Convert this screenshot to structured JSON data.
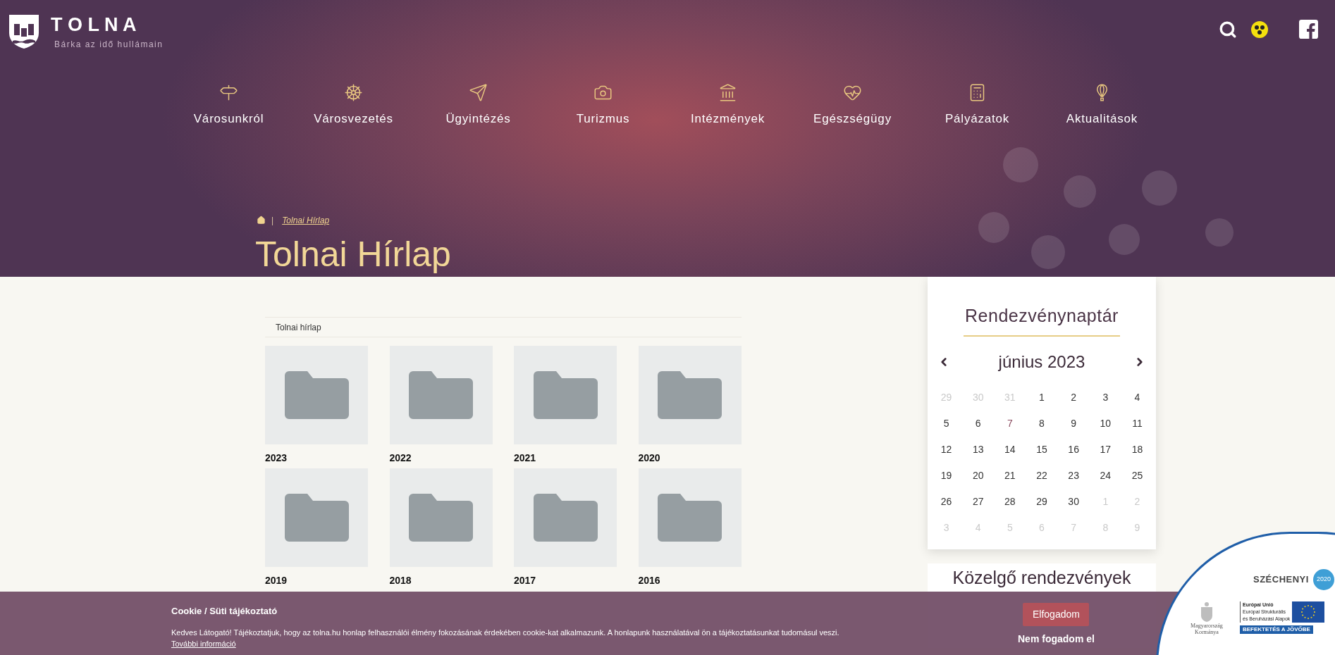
{
  "site": {
    "name": "T O L N A",
    "tagline": "Bárka az idő hullámain"
  },
  "nav": [
    {
      "label": "Városunkról"
    },
    {
      "label": "Városvezetés"
    },
    {
      "label": "Ügyintézés"
    },
    {
      "label": "Turizmus"
    },
    {
      "label": "Intézmények"
    },
    {
      "label": "Egészségügy"
    },
    {
      "label": "Pályázatok"
    },
    {
      "label": "Aktualitások"
    }
  ],
  "breadcrumb": {
    "separator": "|",
    "current": "Tolnai Hírlap"
  },
  "page_title": "Tolnai Hírlap",
  "section_label": "Tolnai hírlap",
  "folders": [
    {
      "label": "2023"
    },
    {
      "label": "2022"
    },
    {
      "label": "2021"
    },
    {
      "label": "2020"
    },
    {
      "label": "2019"
    },
    {
      "label": "2018"
    },
    {
      "label": "2017"
    },
    {
      "label": "2016"
    }
  ],
  "calendar": {
    "title": "Rendezvénynaptár",
    "month": "június 2023",
    "weeks": [
      [
        {
          "day": "29",
          "other_month": true,
          "highlighted": false
        },
        {
          "day": "30",
          "other_month": true,
          "highlighted": false
        },
        {
          "day": "31",
          "other_month": true,
          "highlighted": false
        },
        {
          "day": "1",
          "other_month": false,
          "highlighted": false
        },
        {
          "day": "2",
          "other_month": false,
          "highlighted": false
        },
        {
          "day": "3",
          "other_month": false,
          "highlighted": false
        },
        {
          "day": "4",
          "other_month": false,
          "highlighted": false
        }
      ],
      [
        {
          "day": "5",
          "other_month": false,
          "highlighted": false
        },
        {
          "day": "6",
          "other_month": false,
          "highlighted": false
        },
        {
          "day": "7",
          "other_month": false,
          "highlighted": true
        },
        {
          "day": "8",
          "other_month": false,
          "highlighted": false
        },
        {
          "day": "9",
          "other_month": false,
          "highlighted": false
        },
        {
          "day": "10",
          "other_month": false,
          "highlighted": false
        },
        {
          "day": "11",
          "other_month": false,
          "highlighted": false
        }
      ],
      [
        {
          "day": "12",
          "other_month": false,
          "highlighted": false
        },
        {
          "day": "13",
          "other_month": false,
          "highlighted": false
        },
        {
          "day": "14",
          "other_month": false,
          "highlighted": false
        },
        {
          "day": "15",
          "other_month": false,
          "highlighted": false
        },
        {
          "day": "16",
          "other_month": false,
          "highlighted": false
        },
        {
          "day": "17",
          "other_month": false,
          "highlighted": false
        },
        {
          "day": "18",
          "other_month": false,
          "highlighted": false
        }
      ],
      [
        {
          "day": "19",
          "other_month": false,
          "highlighted": false
        },
        {
          "day": "20",
          "other_month": false,
          "highlighted": false
        },
        {
          "day": "21",
          "other_month": false,
          "highlighted": false
        },
        {
          "day": "22",
          "other_month": false,
          "highlighted": false
        },
        {
          "day": "23",
          "other_month": false,
          "highlighted": false
        },
        {
          "day": "24",
          "other_month": false,
          "highlighted": false
        },
        {
          "day": "25",
          "other_month": false,
          "highlighted": false
        }
      ],
      [
        {
          "day": "26",
          "other_month": false,
          "highlighted": false
        },
        {
          "day": "27",
          "other_month": false,
          "highlighted": false
        },
        {
          "day": "28",
          "other_month": false,
          "highlighted": false
        },
        {
          "day": "29",
          "other_month": false,
          "highlighted": false
        },
        {
          "day": "30",
          "other_month": false,
          "highlighted": false
        },
        {
          "day": "1",
          "other_month": true,
          "highlighted": false
        },
        {
          "day": "2",
          "other_month": true,
          "highlighted": false
        }
      ],
      [
        {
          "day": "3",
          "other_month": true,
          "highlighted": false
        },
        {
          "day": "4",
          "other_month": true,
          "highlighted": false
        },
        {
          "day": "5",
          "other_month": true,
          "highlighted": false
        },
        {
          "day": "6",
          "other_month": true,
          "highlighted": false
        },
        {
          "day": "7",
          "other_month": true,
          "highlighted": false
        },
        {
          "day": "8",
          "other_month": true,
          "highlighted": false
        },
        {
          "day": "9",
          "other_month": true,
          "highlighted": false
        }
      ]
    ]
  },
  "upcoming": {
    "title": "Közelgő rendezvények"
  },
  "cookie_bar": {
    "title": "Cookie / Süti tájékoztató",
    "text": "Kedves Látogató! Tájékoztatjuk, hogy az tolna.hu honlap felhasználói élmény fokozásának érdekében cookie-kat alkalmazunk. A honlapunk használatával ön a tájékoztatásunkat tudomásul veszi.",
    "link": "További információ",
    "accept": "Elfogadom",
    "decline": "Nem fogadom el"
  },
  "badge": {
    "title": "SZÉCHENYI",
    "year": "2020",
    "eu_title": "Európai Unió",
    "eu_line_1": "Európai Strukturális",
    "eu_line_2": "és Beruházási Alapok",
    "gov_line_1": "Magyarország",
    "gov_line_2": "Kormánya",
    "slogan": "BEFEKTETÉS A JÖVŐBE"
  }
}
